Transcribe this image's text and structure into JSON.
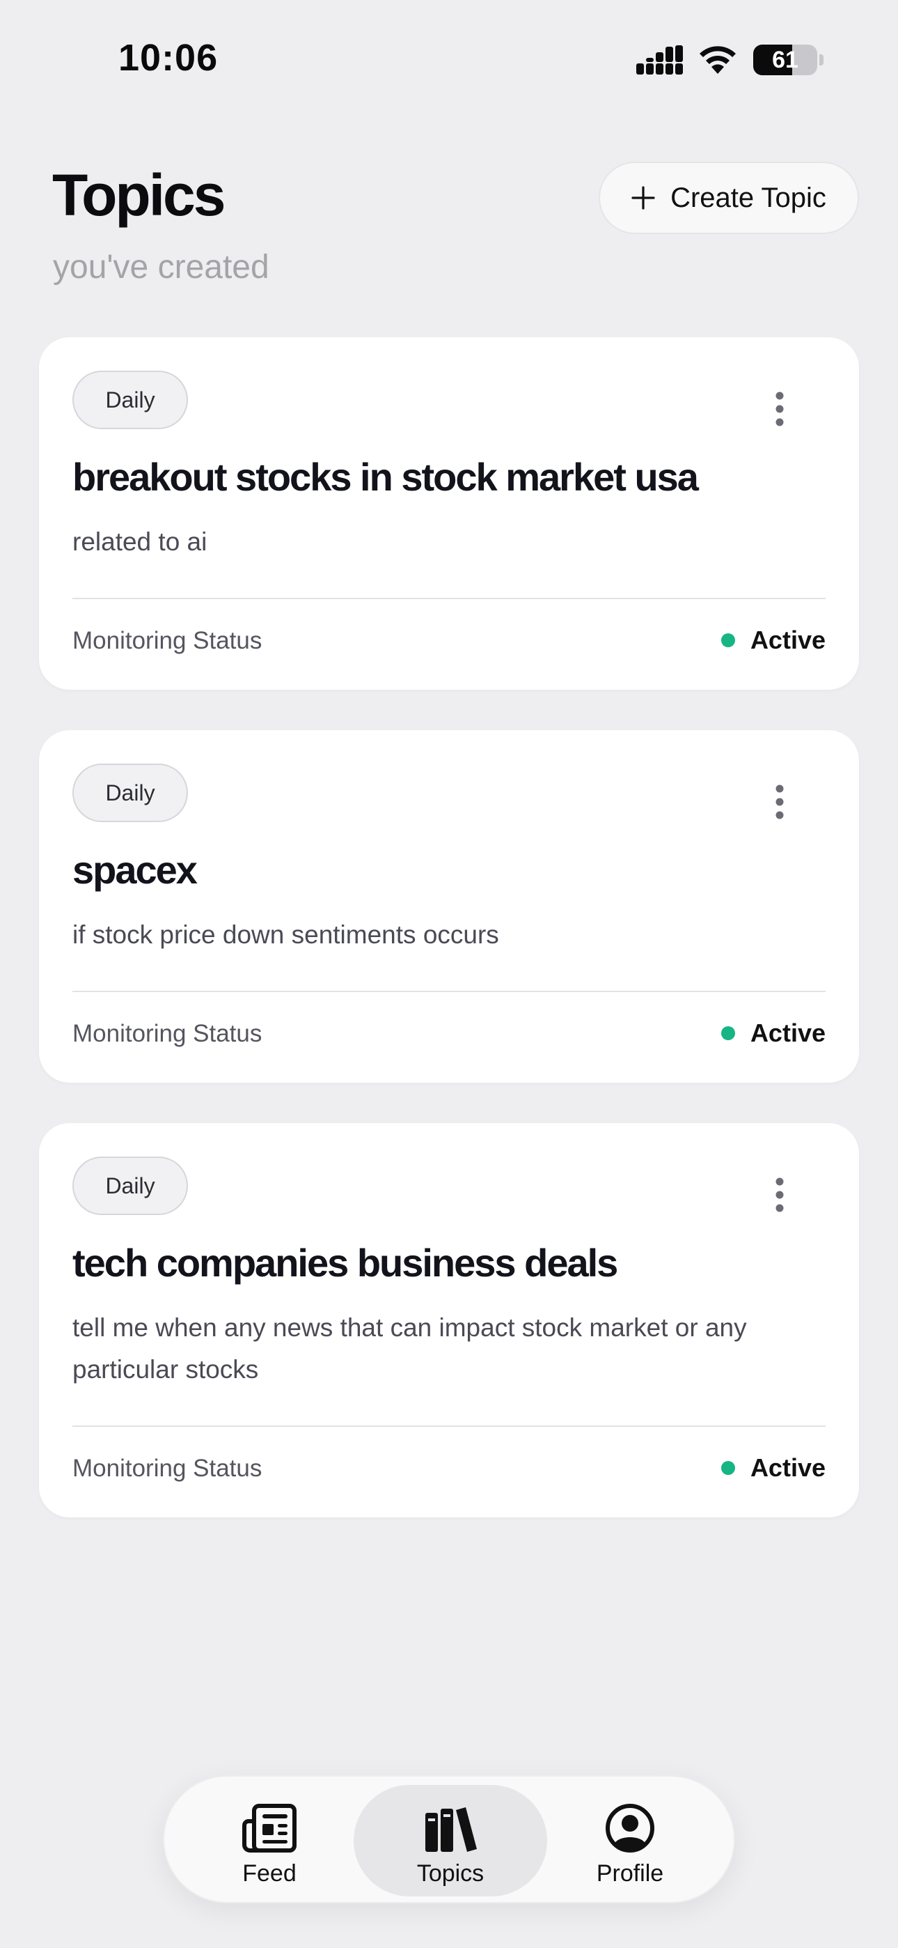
{
  "status_bar": {
    "time": "10:06",
    "battery": "61"
  },
  "header": {
    "title": "Topics",
    "subtitle": "you've created",
    "create_button_label": "Create Topic"
  },
  "topics": [
    {
      "frequency": "Daily",
      "title": "breakout stocks in stock market usa",
      "description": "related to ai",
      "monitoring_label": "Monitoring Status",
      "status": "Active"
    },
    {
      "frequency": "Daily",
      "title": "spacex",
      "description": "if stock price down sentiments occurs",
      "monitoring_label": "Monitoring Status",
      "status": "Active"
    },
    {
      "frequency": "Daily",
      "title": "tech companies business deals",
      "description": "tell me when any news that can impact stock market or any particular stocks",
      "monitoring_label": "Monitoring Status",
      "status": "Active"
    }
  ],
  "nav": {
    "items": [
      {
        "label": "Feed",
        "icon": "newspaper-icon"
      },
      {
        "label": "Topics",
        "icon": "books-icon",
        "active": true
      },
      {
        "label": "Profile",
        "icon": "person-circle-icon"
      }
    ]
  },
  "colors": {
    "background": "#eeeef0",
    "card": "#ffffff",
    "active_status": "#16b583",
    "subtitle": "#a3a3aa"
  }
}
